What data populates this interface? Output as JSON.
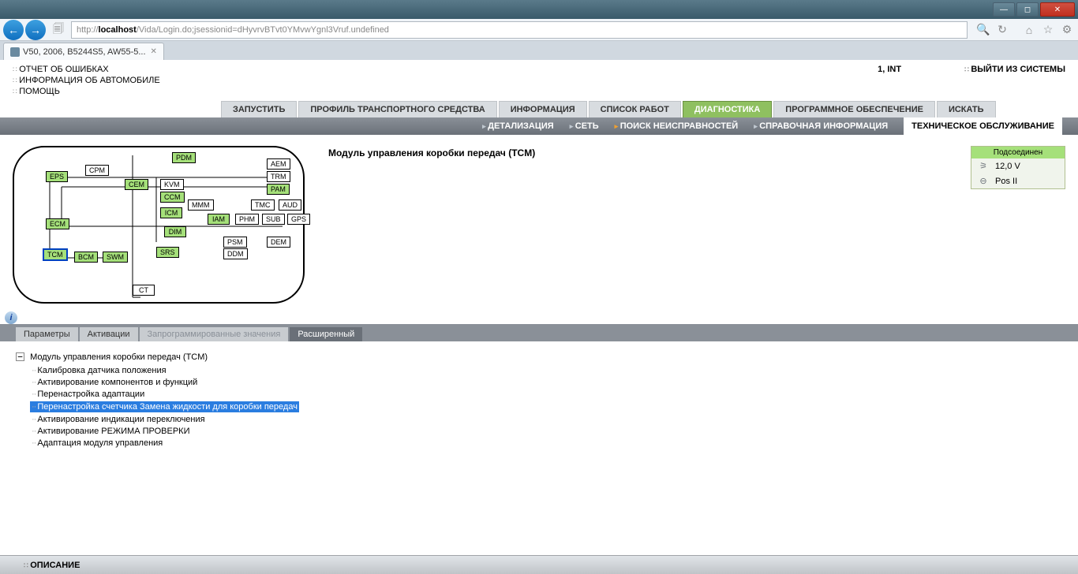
{
  "browser": {
    "url_proto": "http://",
    "url_host": "localhost",
    "url_path": "/Vida/Login.do;jsessionid=dHyvrvBTvt0YMvwYgnl3Vruf.undefined",
    "tab_title": "V50, 2006, B5244S5, AW55-5..."
  },
  "top_links": {
    "l1": "ОТЧЕТ ОБ ОШИБКАХ",
    "l2": "ИНФОРМАЦИЯ ОБ АВТОМОБИЛЕ",
    "l3": "ПОМОЩЬ"
  },
  "user": "1, INT",
  "logout": "ВЫЙТИ ИЗ СИСТЕМЫ",
  "tabs": {
    "t1": "ЗАПУСТИТЬ",
    "t2": "ПРОФИЛЬ ТРАНСПОРТНОГО СРЕДСТВА",
    "t3": "ИНФОРМАЦИЯ",
    "t4": "СПИСОК РАБОТ",
    "t5": "ДИАГНОСТИКА",
    "t6": "ПРОГРАММНОЕ ОБЕСПЕЧЕНИЕ",
    "t7": "ИСКАТЬ"
  },
  "subnav": {
    "s1": "ДЕТАЛИЗАЦИЯ",
    "s2": "СЕТЬ",
    "s3": "ПОИСК НЕИСПРАВНОСТЕЙ",
    "s4": "СПРАВОЧНАЯ ИНФОРМАЦИЯ",
    "s5": "ТЕХНИЧЕСКОЕ ОБСЛУЖИВАНИЕ"
  },
  "heading": "Модуль управления коробки передач (TCM)",
  "status": {
    "header": "Подсоединен",
    "voltage": "12,0 V",
    "position": "Pos II"
  },
  "modules": {
    "EPS": "EPS",
    "CPM": "CPM",
    "PDM": "PDM",
    "AEM": "AEM",
    "TRM": "TRM",
    "CEM": "CEM",
    "KVM": "KVM",
    "PAM": "PAM",
    "CCM": "CCM",
    "MMM": "MMM",
    "TMC": "TMC",
    "AUD": "AUD",
    "ICM": "ICM",
    "IAM": "IAM",
    "PHM": "PHM",
    "SUB": "SUB",
    "GPS": "GPS",
    "DIM": "DIM",
    "ECM": "ECM",
    "PSM": "PSM",
    "DEM": "DEM",
    "SRS": "SRS",
    "DDM": "DDM",
    "TCM": "TCM",
    "BCM": "BCM",
    "SWM": "SWM",
    "CT": "CT"
  },
  "inner_tabs": {
    "it1": "Параметры",
    "it2": "Активации",
    "it3": "Запрограммированные значения",
    "it4": "Расширенный"
  },
  "tree": {
    "root": "Модуль управления коробки передач (TCM)",
    "items": [
      "Калибровка датчика положения",
      "Активирование компонентов и функций",
      "Перенастройка адаптации",
      "Перенастройка счетчика Замена жидкости для коробки передач",
      "Активирование индикации переключения",
      "Активирование РЕЖИМА ПРОВЕРКИ",
      "Адаптация модуля управления"
    ],
    "selected_index": 3
  },
  "footer": "ОПИСАНИЕ"
}
